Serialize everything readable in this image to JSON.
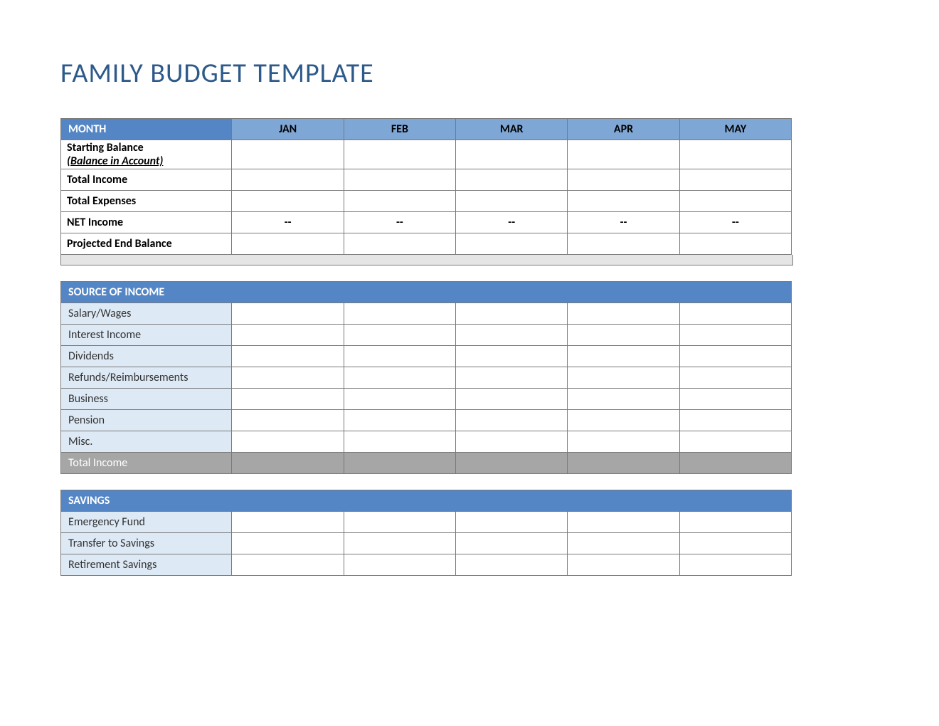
{
  "title": "FAMILY BUDGET TEMPLATE",
  "months": [
    "JAN",
    "FEB",
    "MAR",
    "APR",
    "MAY"
  ],
  "summary": {
    "month_label": "MONTH",
    "starting_line1": "Starting Balance",
    "starting_line2": "(Balance in Account)",
    "total_income": "Total Income",
    "total_expenses": "Total Expenses",
    "net_income": "NET Income",
    "net_values": [
      "--",
      "--",
      "--",
      "--",
      "--"
    ],
    "projected_end": "Projected End Balance"
  },
  "income": {
    "header": "SOURCE OF INCOME",
    "rows": [
      "Salary/Wages",
      "Interest Income",
      "Dividends",
      "Refunds/Reimbursements",
      "Business",
      "Pension",
      "Misc."
    ],
    "total": "Total Income"
  },
  "savings": {
    "header": "SAVINGS",
    "rows": [
      "Emergency Fund",
      "Transfer to Savings",
      "Retirement Savings"
    ]
  }
}
